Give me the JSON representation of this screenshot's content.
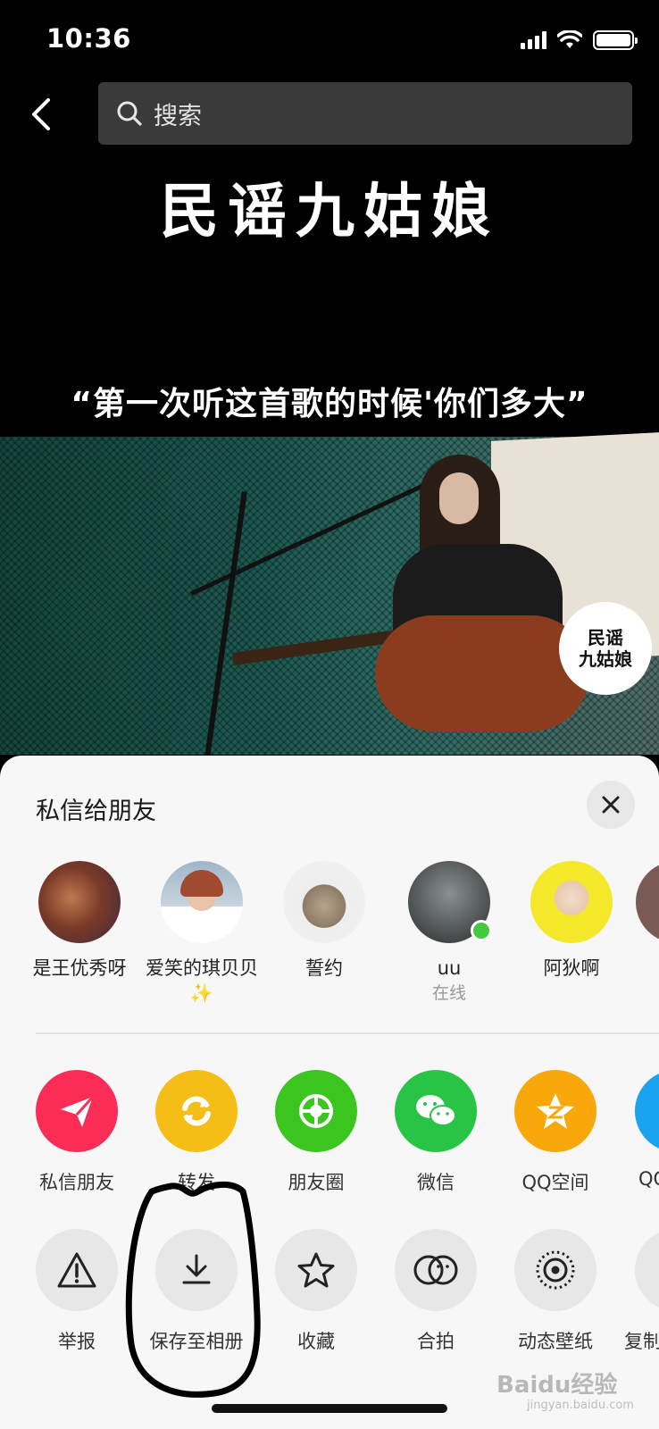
{
  "status_bar": {
    "time": "10:36"
  },
  "search": {
    "placeholder": "搜索"
  },
  "video": {
    "title": "民谣九姑娘",
    "quote": "“第一次听这首歌的时候'你们多大”",
    "badge_line1": "民谣",
    "badge_line2": "九姑娘"
  },
  "share_sheet": {
    "title": "私信给朋友",
    "friends": [
      {
        "name": "是王优秀呀",
        "sub": ""
      },
      {
        "name": "爱笑的琪贝贝✨",
        "sub": ""
      },
      {
        "name": "誓约",
        "sub": ""
      },
      {
        "name": "uu",
        "sub": "在线"
      },
      {
        "name": "阿狄啊",
        "sub": ""
      }
    ],
    "share_actions": [
      "私信朋友",
      "转发",
      "朋友圈",
      "微信",
      "QQ空间",
      "QQ"
    ],
    "more_actions": [
      "举报",
      "保存至相册",
      "收藏",
      "合拍",
      "动态壁纸",
      "复制"
    ]
  },
  "watermark": {
    "text": "Baidu经验",
    "sub": "jingyan.baidu.com"
  },
  "colors": {
    "sheet_bg": "#f7f7f7",
    "dm_red": "#fb2c55",
    "forward_yellow": "#f5be16",
    "moments_green": "#3cc51f",
    "wechat_green": "#28c445",
    "qzone_orange": "#f8a80a",
    "qq_blue": "#1aa3f0"
  }
}
